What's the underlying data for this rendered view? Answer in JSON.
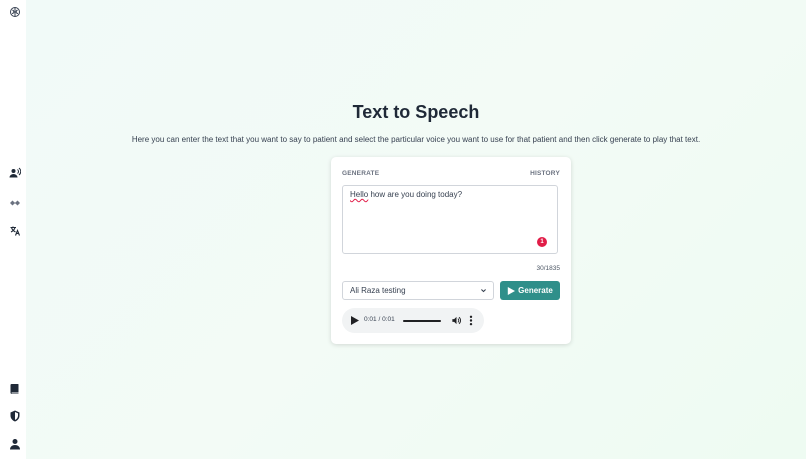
{
  "colors": {
    "accent": "#2f8f8a",
    "error_badge": "#e11d48"
  },
  "sidebar": {
    "top_icon": "brain-icon",
    "items": [
      {
        "icon": "voice-user-icon"
      },
      {
        "icon": "waveform-icon"
      },
      {
        "icon": "translate-icon"
      }
    ],
    "bottom_items": [
      {
        "icon": "book-icon"
      },
      {
        "icon": "shield-icon"
      },
      {
        "icon": "user-icon"
      }
    ]
  },
  "page": {
    "title": "Text to Speech",
    "subtitle": "Here you can enter the text that you want to say to patient and select the particular voice you want to use for that patient and then click generate to play that text."
  },
  "card": {
    "tabs": {
      "generate": "GENERATE",
      "history": "HISTORY"
    },
    "text": {
      "misspelled": "Hello",
      "rest": " how are you doing today?"
    },
    "error_count": "1",
    "counter": "30/1835",
    "voice_select": {
      "selected": "Ali Raza testing"
    },
    "generate_label": "Generate",
    "audio": {
      "time": "0:01 / 0:01",
      "progress": 1.0
    }
  }
}
